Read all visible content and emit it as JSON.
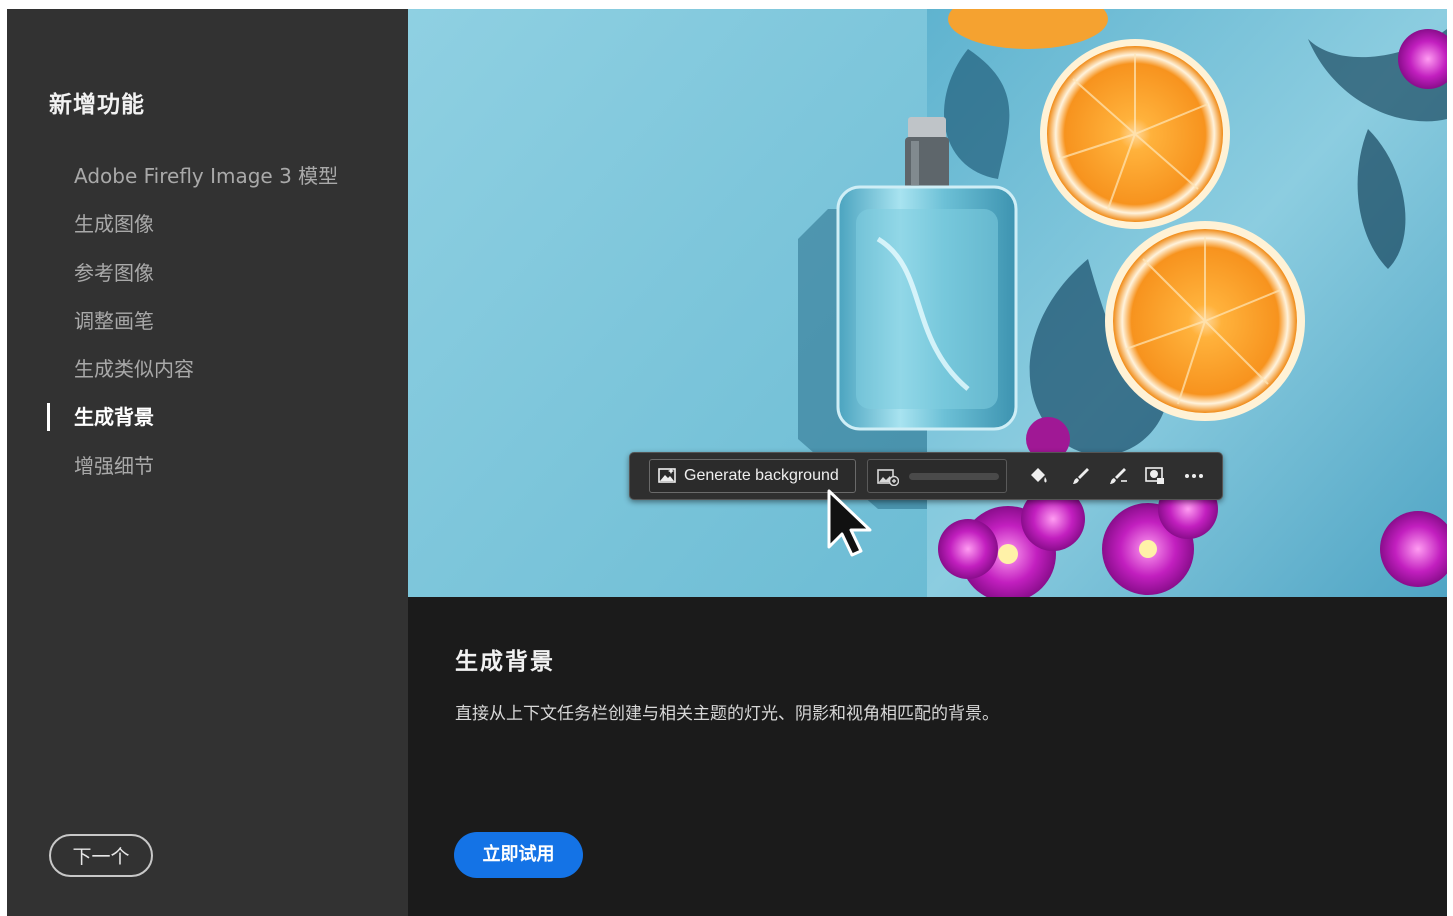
{
  "sidebar": {
    "title": "新增功能",
    "items": [
      {
        "label": "Adobe Firefly Image 3 模型",
        "active": false
      },
      {
        "label": "生成图像",
        "active": false
      },
      {
        "label": "参考图像",
        "active": false
      },
      {
        "label": "调整画笔",
        "active": false
      },
      {
        "label": "生成类似内容",
        "active": false
      },
      {
        "label": "生成背景",
        "active": true
      },
      {
        "label": "增强细节",
        "active": false
      }
    ],
    "next_label": "下一个"
  },
  "preview": {
    "toolbar": {
      "generate_label": "Generate background",
      "icons": [
        "generate-background-icon",
        "variations-icon",
        "fill-bucket-icon",
        "brush-icon",
        "brush-edit-icon",
        "mask-icon",
        "more-icon"
      ]
    }
  },
  "feature": {
    "title": "生成背景",
    "description": "直接从上下文任务栏创建与相关主题的灯光、阴影和视角相匹配的背景。",
    "cta_label": "立即试用"
  },
  "colors": {
    "sidebar_bg": "#323232",
    "content_bg": "#1b1b1b",
    "accent": "#1473e6"
  }
}
